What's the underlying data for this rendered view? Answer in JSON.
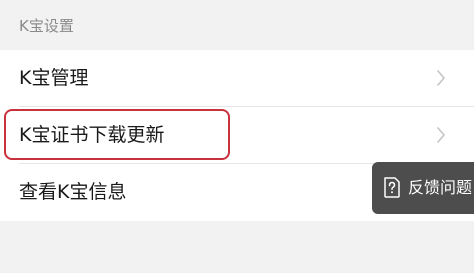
{
  "section": {
    "title": "K宝设置"
  },
  "items": [
    {
      "label": "K宝管理",
      "chevron_icon": "chevron-right-icon"
    },
    {
      "label": "K宝证书下载更新",
      "chevron_icon": "chevron-right-icon"
    },
    {
      "label": "查看K宝信息"
    }
  ],
  "feedback": {
    "label": "反馈问题",
    "icon": "feedback-question-icon"
  },
  "colors": {
    "background": "#f2f2f2",
    "row_background": "#ffffff",
    "highlight_border": "#c8323c",
    "feedback_background": "#4d4d4d"
  }
}
